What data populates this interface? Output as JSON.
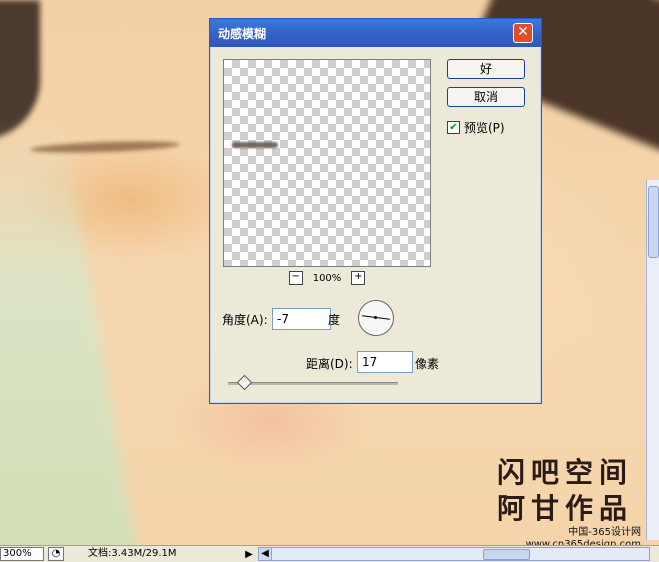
{
  "dialog": {
    "title": "动感模糊",
    "close_symbol": "✕",
    "ok_label": "好",
    "cancel_label": "取消",
    "preview_label": "预览(P)",
    "preview_checked": true,
    "zoom_out_symbol": "−",
    "zoom_in_symbol": "+",
    "zoom_percent": "100%",
    "angle_label": "角度(A):",
    "angle_value": "-7",
    "angle_unit": "度",
    "distance_label": "距离(D):",
    "distance_value": "17",
    "distance_unit": "像素"
  },
  "watermark": {
    "line1": "闪吧空间",
    "line2": "阿甘作品",
    "site_cn": "中国-365设计网",
    "site_url": "www.cn365design.com"
  },
  "statusbar": {
    "zoom": "300%",
    "doc_info": "文档:3.43M/29.1M",
    "arrow": "▶",
    "left_arrow": "◀"
  },
  "colors": {
    "title_bar": "#3461c8",
    "dialog_bg": "#ece9d8",
    "skin_bg": "#f6d7b2"
  }
}
